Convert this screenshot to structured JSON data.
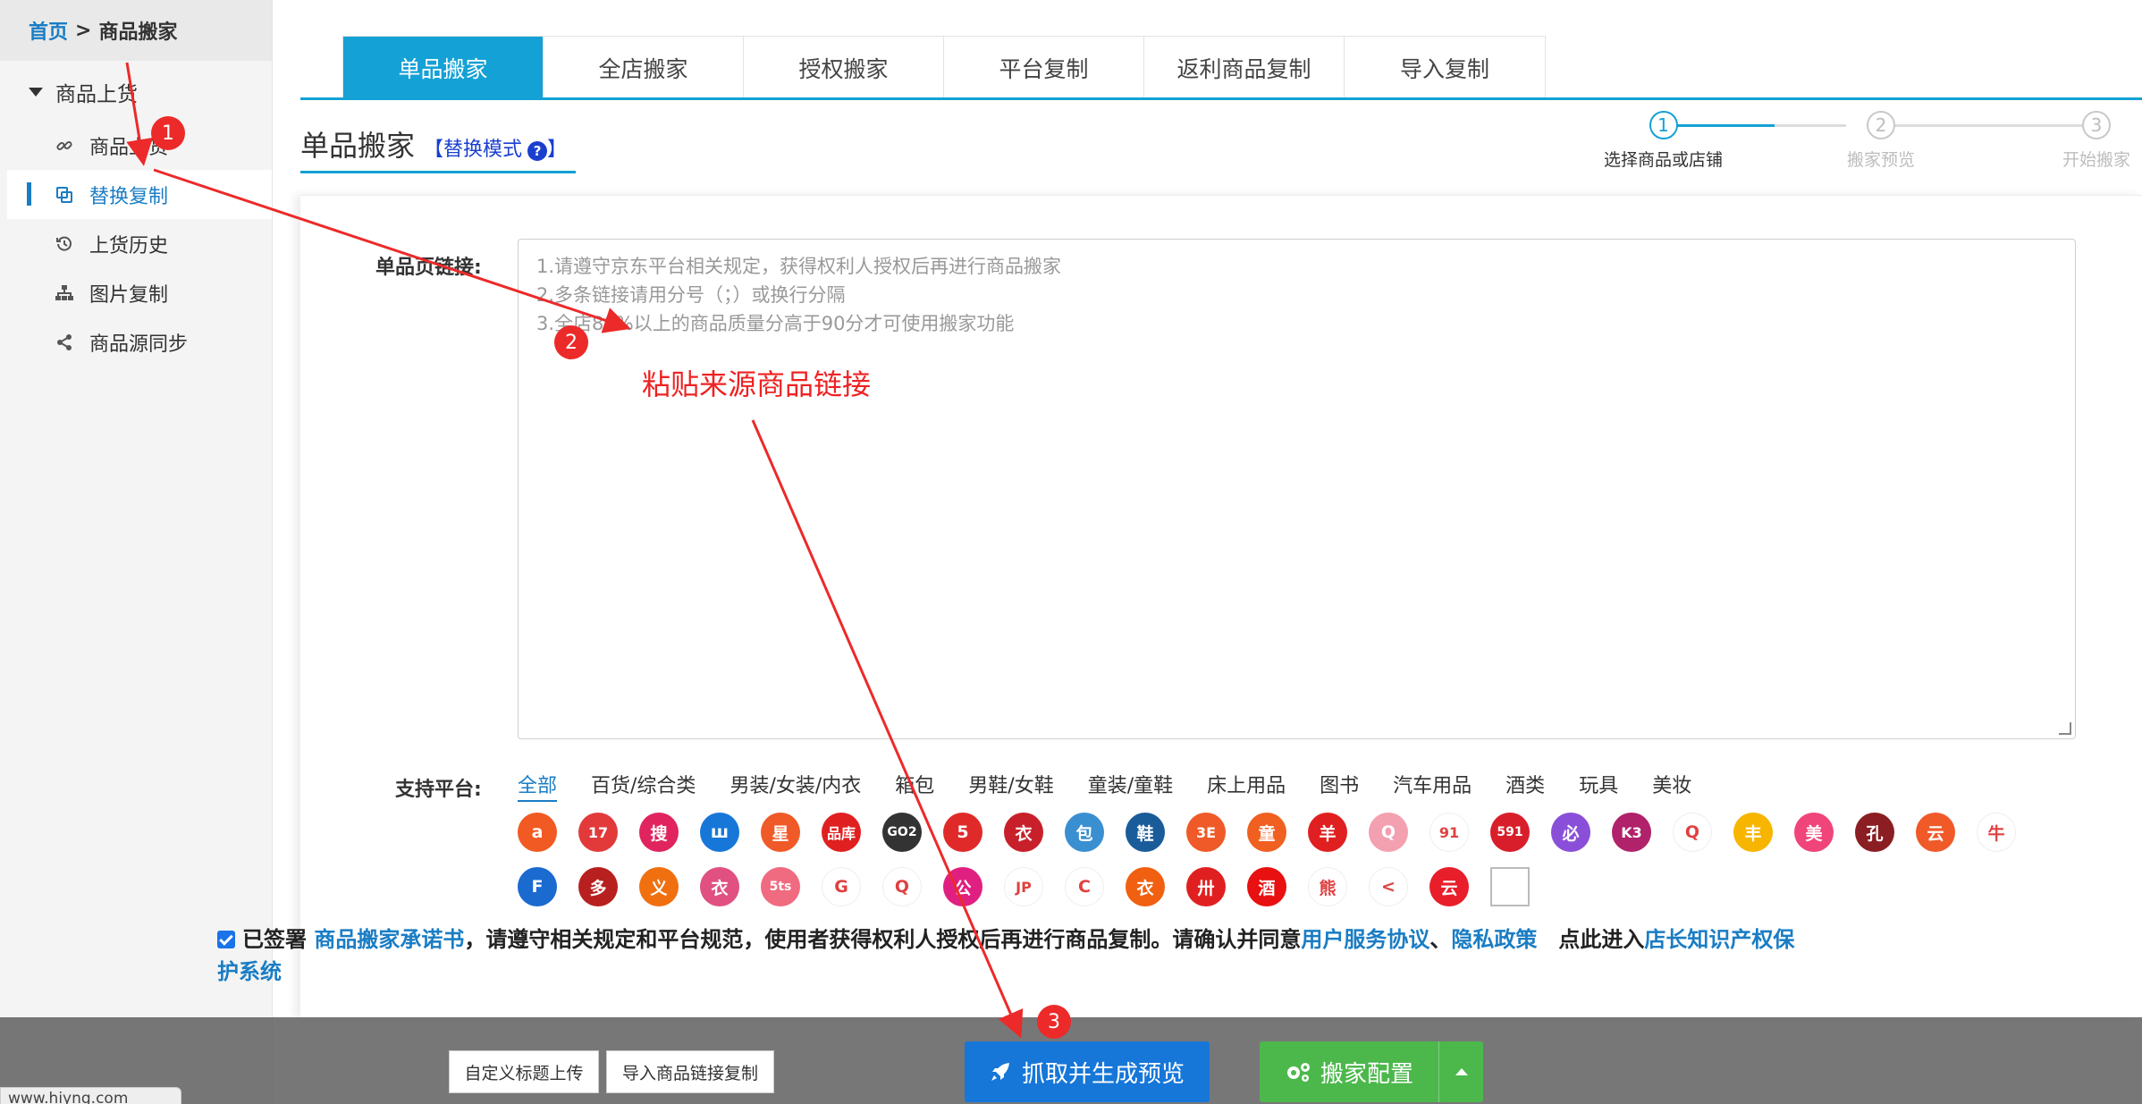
{
  "breadcrumb": {
    "home": "首页",
    "sep": ">",
    "current": "商品搬家"
  },
  "sidebar": {
    "group": "商品上货",
    "items": [
      {
        "label": "商品上货",
        "icon": "link-icon"
      },
      {
        "label": "替换复制",
        "icon": "copy-icon",
        "active": true
      },
      {
        "label": "上货历史",
        "icon": "history-icon"
      },
      {
        "label": "图片复制",
        "icon": "sitemap-icon"
      },
      {
        "label": "商品源同步",
        "icon": "share-icon"
      }
    ]
  },
  "tabs": [
    "单品搬家",
    "全店搬家",
    "授权搬家",
    "平台复制",
    "返利商品复制",
    "导入复制"
  ],
  "page": {
    "title": "单品搬家",
    "mode_open": "【",
    "mode": "替换模式",
    "mode_close": "】",
    "help": "?"
  },
  "steps": [
    {
      "num": "1",
      "label": "选择商品或店铺"
    },
    {
      "num": "2",
      "label": "搬家预览"
    },
    {
      "num": "3",
      "label": "开始搬家"
    }
  ],
  "form": {
    "link_label": "单品页链接:",
    "placeholder": [
      "1.请遵守京东平台相关规定，获得权利人授权后再进行商品搬家",
      "2.多条链接请用分号（；）或换行分隔",
      "3.全店80%以上的商品质量分高于90分才可使用搬家功能"
    ],
    "annotation": "粘贴来源商品链接",
    "platform_label": "支持平台:",
    "categories": [
      "全部",
      "百货/综合类",
      "男装/女装/内衣",
      "箱包",
      "男鞋/女鞋",
      "童装/童鞋",
      "床上用品",
      "图书",
      "汽车用品",
      "酒类",
      "玩具",
      "美妆"
    ]
  },
  "platforms_row1": [
    {
      "g": "a",
      "c": "#f15a22"
    },
    {
      "g": "17",
      "c": "#e23a3a"
    },
    {
      "g": "搜",
      "c": "#e0245e"
    },
    {
      "g": "ш",
      "c": "#1677d9"
    },
    {
      "g": "星",
      "c": "#f05a28"
    },
    {
      "g": "品库",
      "c": "#e02020"
    },
    {
      "g": "GO2",
      "c": "#333333"
    },
    {
      "g": "5",
      "c": "#e02a2a"
    },
    {
      "g": "衣",
      "c": "#c8202a"
    },
    {
      "g": "包",
      "c": "#3a8fd0"
    },
    {
      "g": "鞋",
      "c": "#1a5c9a"
    },
    {
      "g": "3E",
      "c": "#f05a28"
    },
    {
      "g": "童",
      "c": "#f06020"
    },
    {
      "g": "羊",
      "c": "#e02020"
    },
    {
      "g": "Q",
      "c": "#f3a0b0"
    },
    {
      "g": "91",
      "c": "#ffffff"
    },
    {
      "g": "591",
      "c": "#d81e2a"
    },
    {
      "g": "必",
      "c": "#8a4fd8"
    },
    {
      "g": "K3",
      "c": "#b0226a"
    },
    {
      "g": "Q",
      "c": "#ffffff"
    },
    {
      "g": "丰",
      "c": "#f7b500"
    },
    {
      "g": "美",
      "c": "#f0457a"
    },
    {
      "g": "孔",
      "c": "#8a1e22"
    },
    {
      "g": "云",
      "c": "#f05a28"
    },
    {
      "g": "牛",
      "c": "#ffffff"
    }
  ],
  "platforms_row2": [
    {
      "g": "F",
      "c": "#1a6ad0"
    },
    {
      "g": "多",
      "c": "#b82020"
    },
    {
      "g": "义",
      "c": "#f07010"
    },
    {
      "g": "衣",
      "c": "#e05080"
    },
    {
      "g": "5ts",
      "c": "#f06a80"
    },
    {
      "g": "G",
      "c": "#ffffff"
    },
    {
      "g": "Q",
      "c": "#ffffff"
    },
    {
      "g": "公",
      "c": "#e02080"
    },
    {
      "g": "JP",
      "c": "#ffffff"
    },
    {
      "g": "C",
      "c": "#ffffff"
    },
    {
      "g": "衣",
      "c": "#f06010"
    },
    {
      "g": "卅",
      "c": "#e02020"
    },
    {
      "g": "酒",
      "c": "#e81010"
    },
    {
      "g": "熊",
      "c": "#ffffff"
    },
    {
      "g": "<",
      "c": "#ffffff"
    },
    {
      "g": "云",
      "c": "#e81e2a"
    },
    {
      "g": "",
      "c": "#ffffff"
    }
  ],
  "agreement": {
    "prefix": "已签署 ",
    "commit_link": "商品搬家承诺书",
    "middle": "，请遵守相关规定和平台规范，使用者获得权利人授权后再进行商品复制。请确认并同意",
    "user_link": "用户服务协议",
    "dun": "、",
    "privacy_link": "隐私政策",
    "enter": "　点此进入",
    "ip_link": "店长知识产权保护系统"
  },
  "footer": {
    "custom_upload": "自定义标题上传",
    "import_links": "导入商品链接复制",
    "grab": "抓取并生成预览",
    "config": "搬家配置"
  },
  "markers": [
    "1",
    "2",
    "3"
  ],
  "url_text": "www.hiyng.com",
  "colors": {
    "accent": "#14a1d5",
    "primary": "#1677d9",
    "success": "#4cb84c",
    "annot": "#ec2a2a"
  }
}
